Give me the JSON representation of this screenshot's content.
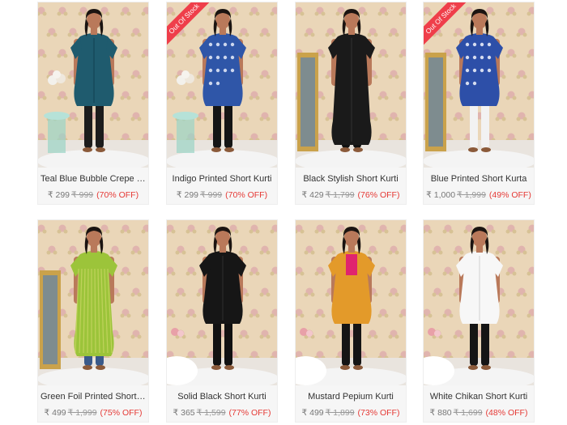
{
  "products": [
    {
      "title": "Teal Blue Bubble Crepe Sh...",
      "price": "₹ 299",
      "mrp": "₹ 999",
      "discount": "(70% OFF)",
      "out_of_stock": false,
      "garment_color": "#1f5b6e",
      "accent_color": "#174a5a",
      "legs_color": "#1c1c1c"
    },
    {
      "title": "Indigo Printed Short Kurti",
      "price": "₹ 299",
      "mrp": "₹ 999",
      "discount": "(70% OFF)",
      "out_of_stock": true,
      "ribbon_label": "Out Of Stock",
      "garment_color": "#2f56a8",
      "accent_color": "#dfe6f5",
      "legs_color": "#151515"
    },
    {
      "title": "Black Stylish Short Kurti",
      "price": "₹ 429",
      "mrp": "₹ 1,799",
      "discount": "(76% OFF)",
      "out_of_stock": false,
      "garment_color": "#1a1a1a",
      "accent_color": "#2b2b2b",
      "legs_color": "#111111"
    },
    {
      "title": "Blue Printed Short Kurta",
      "price": "₹ 1,000",
      "mrp": "₹ 1,999",
      "discount": "(49% OFF)",
      "out_of_stock": true,
      "ribbon_label": "Out Of Stock",
      "garment_color": "#2d4fa8",
      "accent_color": "#e9ecf7",
      "legs_color": "#f2f2f2"
    },
    {
      "title": "Green Foil Printed Short Ku...",
      "price": "₹ 499",
      "mrp": "₹ 1,999",
      "discount": "(75% OFF)",
      "out_of_stock": false,
      "garment_color": "#9cc43a",
      "accent_color": "#cfd96a",
      "legs_color": "#3a5a8a"
    },
    {
      "title": "Solid Black Short Kurti",
      "price": "₹ 365",
      "mrp": "₹ 1,599",
      "discount": "(77% OFF)",
      "out_of_stock": false,
      "garment_color": "#161616",
      "accent_color": "#262626",
      "legs_color": "#111111"
    },
    {
      "title": "Mustard Pepium Kurti",
      "price": "₹ 499",
      "mrp": "₹ 1,899",
      "discount": "(73% OFF)",
      "out_of_stock": false,
      "garment_color": "#e39a2a",
      "accent_color": "#e0246e",
      "legs_color": "#151515"
    },
    {
      "title": "White Chikan Short Kurti",
      "price": "₹ 880",
      "mrp": "₹ 1,699",
      "discount": "(48% OFF)",
      "out_of_stock": false,
      "garment_color": "#f7f7f7",
      "accent_color": "#dddddd",
      "legs_color": "#151515"
    }
  ],
  "colors": {
    "wallpaper": "#ead6b8",
    "wallpaper_flower": "#d89aa6",
    "discount": "#e53935",
    "ribbon": "#ef3e4a",
    "skin": "#b9795a",
    "hair": "#1b1411"
  }
}
